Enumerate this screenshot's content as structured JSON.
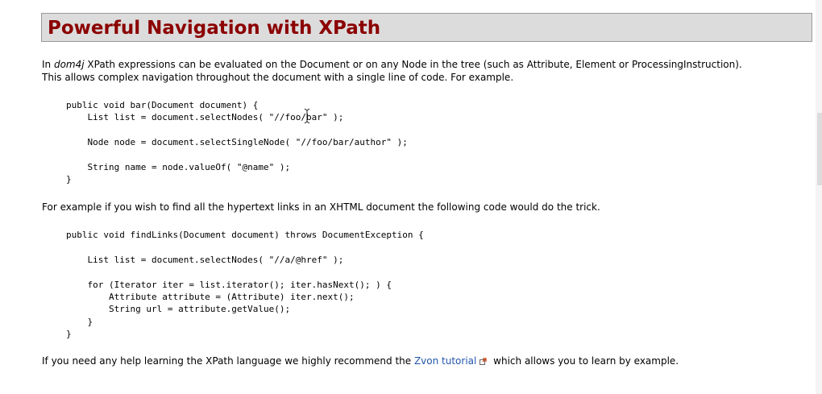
{
  "header": {
    "title": "Powerful Navigation with XPath"
  },
  "intro": {
    "line1_pre": "In ",
    "line1_em": "dom4j",
    "line1_post": " XPath expressions can be evaluated on the Document or on any Node in the tree (such as Attribute, Element or ProcessingInstruction).",
    "line2": "This allows complex navigation throughout the document with a single line of code. For example."
  },
  "code1": {
    "lines": [
      "public void bar(Document document) {",
      "    List list = document.selectNodes( \"//foo/bar\" );",
      "",
      "    Node node = document.selectSingleNode( \"//foo/bar/author\" );",
      "",
      "    String name = node.valueOf( \"@name\" );",
      "}"
    ]
  },
  "para2": {
    "text": "For example if you wish to find all the hypertext links in an XHTML document the following code would do the trick."
  },
  "code2": {
    "lines": [
      "public void findLinks(Document document) throws DocumentException {",
      "",
      "    List list = document.selectNodes( \"//a/@href\" );",
      "",
      "    for (Iterator iter = list.iterator(); iter.hasNext(); ) {",
      "        Attribute attribute = (Attribute) iter.next();",
      "        String url = attribute.getValue();",
      "    }",
      "}"
    ]
  },
  "para3": {
    "pre": "If you need any help learning the XPath language we highly recommend the ",
    "link": "Zvon tutorial",
    "post": " which allows you to learn by example."
  },
  "colors": {
    "title": "#8b0000",
    "header_bg": "#dcdcdc",
    "link": "#2255aa"
  },
  "icons": {
    "external_link": "external-link-icon",
    "cursor": "text-cursor-icon"
  }
}
